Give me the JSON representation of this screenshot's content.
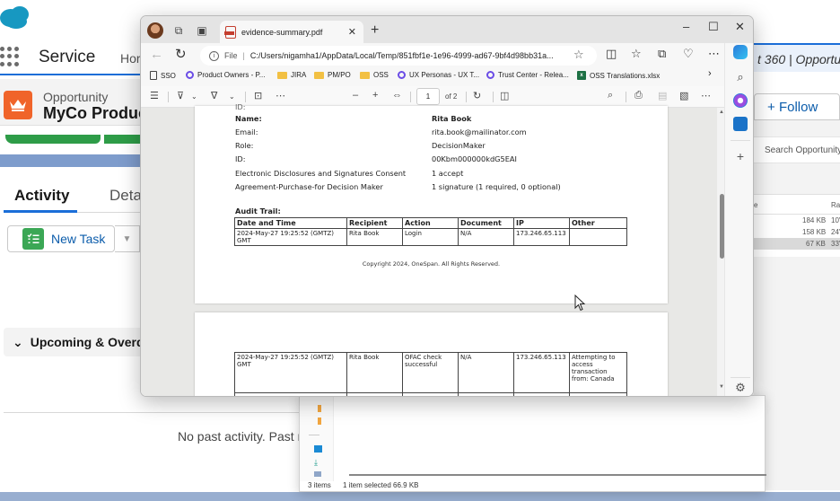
{
  "salesforce": {
    "app_name": "Service",
    "nav_home": "Hor",
    "object_label": "Opportunity",
    "record_name": "MyCo Produc",
    "tabs": [
      {
        "label": "Activity",
        "active": true
      },
      {
        "label": "Detai",
        "active": false
      }
    ],
    "new_task_label": "New Task",
    "upcoming_label": "Upcoming & Overdu",
    "no_past_activity": "No past activity. Past me",
    "right_title": "t 360 | Opportuni",
    "follow_label": "Follow",
    "search_placeholder": "Search Opportunity-",
    "file_list": {
      "headers": [
        "e",
        "Ra"
      ],
      "rows": [
        {
          "size": "184 KB",
          "rate": "10'",
          "selected": false
        },
        {
          "size": "158 KB",
          "rate": "24'",
          "selected": false
        },
        {
          "size": "67 KB",
          "rate": "33'",
          "selected": true
        }
      ]
    }
  },
  "explorer": {
    "items_count": "3 items",
    "selection": "1 item selected  66.9 KB"
  },
  "browser": {
    "tab_title": "evidence-summary.pdf",
    "url_scheme_label": "File",
    "url": "C:/Users/nigamha1/AppData/Local/Temp/851fbf1e-1e96-4999-ad67-9bf4d98bb31a...",
    "favorites": [
      {
        "label": "SSO",
        "icon": "page-icon"
      },
      {
        "label": "Product Owners - P...",
        "icon": "ring-icon"
      },
      {
        "label": "JIRA",
        "icon": "folder-icon"
      },
      {
        "label": "PM/PO",
        "icon": "folder-icon"
      },
      {
        "label": "OSS",
        "icon": "folder-icon"
      },
      {
        "label": "UX Personas - UX T...",
        "icon": "ring-icon"
      },
      {
        "label": "Trust Center - Relea...",
        "icon": "ring-icon"
      },
      {
        "label": "OSS Translations.xlsx",
        "icon": "excel-icon"
      }
    ],
    "pdf_toolbar": {
      "current_page": "1",
      "page_total": "of 2"
    }
  },
  "pdf": {
    "page1": {
      "partial_top_label": "ID:",
      "fields": [
        {
          "label": "Name:",
          "value": "Rita Book",
          "bold": true
        },
        {
          "label": "Email:",
          "value": "rita.book@mailinator.com",
          "bold": false
        },
        {
          "label": "Role:",
          "value": "DecisionMaker",
          "bold": false
        },
        {
          "label": "ID:",
          "value": "00Kbm000000kdG5EAI",
          "bold": false
        },
        {
          "label": "Electronic Disclosures and Signatures Consent",
          "value": "1 accept",
          "bold": false
        },
        {
          "label": "Agreement-Purchase-for Decision Maker",
          "value": "1 signature (1 required, 0 optional)",
          "bold": false
        }
      ],
      "audit_title": "Audit Trail:",
      "audit_headers": [
        "Date and Time",
        "Recipient",
        "Action",
        "Document",
        "IP",
        "Other"
      ],
      "audit_rows": [
        [
          "2024-May-27 19:25:52 (GMTZ) GMT",
          "Rita Book",
          "Login",
          "N/A",
          "173.246.65.113",
          ""
        ]
      ],
      "copyright": "Copyright 2024, OneSpan. All Rights Reserved."
    },
    "page2": {
      "audit_rows": [
        [
          "2024-May-27 19:25:52 (GMTZ) GMT",
          "Rita Book",
          "OFAC check successful",
          "N/A",
          "173.246.65.113",
          "Attempting to access transaction from: Canada"
        ]
      ]
    }
  }
}
